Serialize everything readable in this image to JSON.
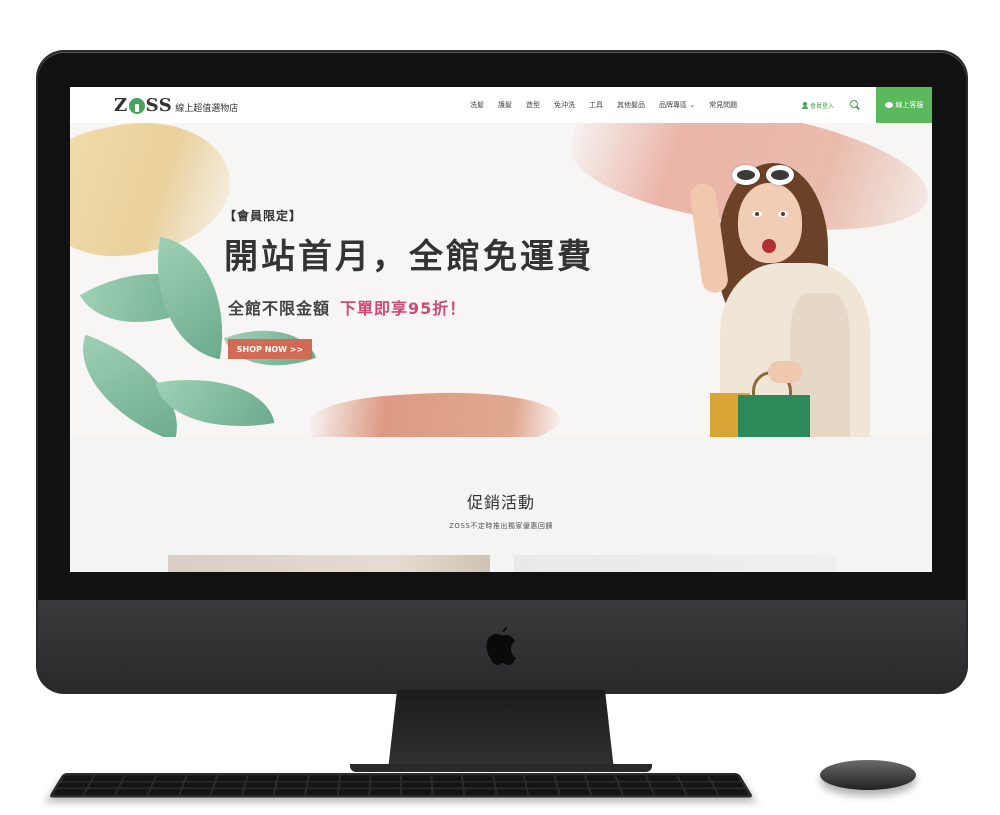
{
  "header": {
    "logo_text_left": "Z",
    "logo_text_right": "SS",
    "logo_subtitle": "線上超值選物店",
    "menu": [
      {
        "label": "洗髮"
      },
      {
        "label": "護髮"
      },
      {
        "label": "造型"
      },
      {
        "label": "免沖洗"
      },
      {
        "label": "工具"
      },
      {
        "label": "其他髮品"
      },
      {
        "label": "品牌專區"
      },
      {
        "label": "常見問題"
      }
    ],
    "member_login": "會員登入",
    "customer_service": "線上客服",
    "accent_color": "#5cb85c"
  },
  "hero": {
    "tag": "【會員限定】",
    "headline": "開站首月，全館免運費",
    "subline_left": "全館不限金額",
    "subline_accent": "下單即享95折！",
    "cta_label": "SHOP NOW >>",
    "cta_color": "#d26b55",
    "accent_color": "#c94d73",
    "slides": 3,
    "active_slide": 1
  },
  "promo": {
    "title": "促銷活動",
    "subtitle": "ZOSS不定時推出獨家優惠回饋"
  },
  "icons": [
    "apple-logo-icon",
    "user-icon",
    "search-icon",
    "chat-bubble-icon"
  ]
}
